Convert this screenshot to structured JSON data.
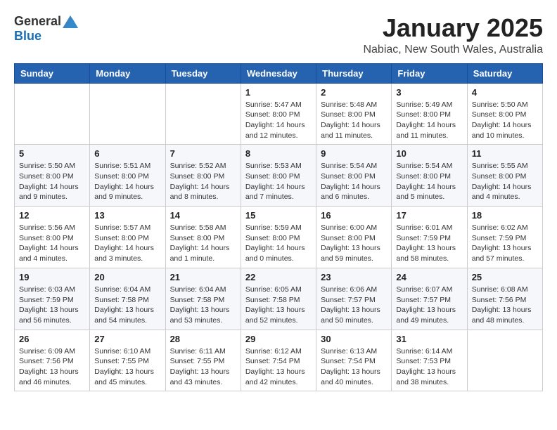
{
  "header": {
    "logo": {
      "general": "General",
      "blue": "Blue"
    },
    "title": "January 2025",
    "subtitle": "Nabiac, New South Wales, Australia"
  },
  "days_of_week": [
    "Sunday",
    "Monday",
    "Tuesday",
    "Wednesday",
    "Thursday",
    "Friday",
    "Saturday"
  ],
  "weeks": [
    {
      "cells": [
        {
          "day": "",
          "info": ""
        },
        {
          "day": "",
          "info": ""
        },
        {
          "day": "",
          "info": ""
        },
        {
          "day": "1",
          "info": "Sunrise: 5:47 AM\nSunset: 8:00 PM\nDaylight: 14 hours and 12 minutes."
        },
        {
          "day": "2",
          "info": "Sunrise: 5:48 AM\nSunset: 8:00 PM\nDaylight: 14 hours and 11 minutes."
        },
        {
          "day": "3",
          "info": "Sunrise: 5:49 AM\nSunset: 8:00 PM\nDaylight: 14 hours and 11 minutes."
        },
        {
          "day": "4",
          "info": "Sunrise: 5:50 AM\nSunset: 8:00 PM\nDaylight: 14 hours and 10 minutes."
        }
      ]
    },
    {
      "cells": [
        {
          "day": "5",
          "info": "Sunrise: 5:50 AM\nSunset: 8:00 PM\nDaylight: 14 hours and 9 minutes."
        },
        {
          "day": "6",
          "info": "Sunrise: 5:51 AM\nSunset: 8:00 PM\nDaylight: 14 hours and 9 minutes."
        },
        {
          "day": "7",
          "info": "Sunrise: 5:52 AM\nSunset: 8:00 PM\nDaylight: 14 hours and 8 minutes."
        },
        {
          "day": "8",
          "info": "Sunrise: 5:53 AM\nSunset: 8:00 PM\nDaylight: 14 hours and 7 minutes."
        },
        {
          "day": "9",
          "info": "Sunrise: 5:54 AM\nSunset: 8:00 PM\nDaylight: 14 hours and 6 minutes."
        },
        {
          "day": "10",
          "info": "Sunrise: 5:54 AM\nSunset: 8:00 PM\nDaylight: 14 hours and 5 minutes."
        },
        {
          "day": "11",
          "info": "Sunrise: 5:55 AM\nSunset: 8:00 PM\nDaylight: 14 hours and 4 minutes."
        }
      ]
    },
    {
      "cells": [
        {
          "day": "12",
          "info": "Sunrise: 5:56 AM\nSunset: 8:00 PM\nDaylight: 14 hours and 4 minutes."
        },
        {
          "day": "13",
          "info": "Sunrise: 5:57 AM\nSunset: 8:00 PM\nDaylight: 14 hours and 3 minutes."
        },
        {
          "day": "14",
          "info": "Sunrise: 5:58 AM\nSunset: 8:00 PM\nDaylight: 14 hours and 1 minute."
        },
        {
          "day": "15",
          "info": "Sunrise: 5:59 AM\nSunset: 8:00 PM\nDaylight: 14 hours and 0 minutes."
        },
        {
          "day": "16",
          "info": "Sunrise: 6:00 AM\nSunset: 8:00 PM\nDaylight: 13 hours and 59 minutes."
        },
        {
          "day": "17",
          "info": "Sunrise: 6:01 AM\nSunset: 7:59 PM\nDaylight: 13 hours and 58 minutes."
        },
        {
          "day": "18",
          "info": "Sunrise: 6:02 AM\nSunset: 7:59 PM\nDaylight: 13 hours and 57 minutes."
        }
      ]
    },
    {
      "cells": [
        {
          "day": "19",
          "info": "Sunrise: 6:03 AM\nSunset: 7:59 PM\nDaylight: 13 hours and 56 minutes."
        },
        {
          "day": "20",
          "info": "Sunrise: 6:04 AM\nSunset: 7:58 PM\nDaylight: 13 hours and 54 minutes."
        },
        {
          "day": "21",
          "info": "Sunrise: 6:04 AM\nSunset: 7:58 PM\nDaylight: 13 hours and 53 minutes."
        },
        {
          "day": "22",
          "info": "Sunrise: 6:05 AM\nSunset: 7:58 PM\nDaylight: 13 hours and 52 minutes."
        },
        {
          "day": "23",
          "info": "Sunrise: 6:06 AM\nSunset: 7:57 PM\nDaylight: 13 hours and 50 minutes."
        },
        {
          "day": "24",
          "info": "Sunrise: 6:07 AM\nSunset: 7:57 PM\nDaylight: 13 hours and 49 minutes."
        },
        {
          "day": "25",
          "info": "Sunrise: 6:08 AM\nSunset: 7:56 PM\nDaylight: 13 hours and 48 minutes."
        }
      ]
    },
    {
      "cells": [
        {
          "day": "26",
          "info": "Sunrise: 6:09 AM\nSunset: 7:56 PM\nDaylight: 13 hours and 46 minutes."
        },
        {
          "day": "27",
          "info": "Sunrise: 6:10 AM\nSunset: 7:55 PM\nDaylight: 13 hours and 45 minutes."
        },
        {
          "day": "28",
          "info": "Sunrise: 6:11 AM\nSunset: 7:55 PM\nDaylight: 13 hours and 43 minutes."
        },
        {
          "day": "29",
          "info": "Sunrise: 6:12 AM\nSunset: 7:54 PM\nDaylight: 13 hours and 42 minutes."
        },
        {
          "day": "30",
          "info": "Sunrise: 6:13 AM\nSunset: 7:54 PM\nDaylight: 13 hours and 40 minutes."
        },
        {
          "day": "31",
          "info": "Sunrise: 6:14 AM\nSunset: 7:53 PM\nDaylight: 13 hours and 38 minutes."
        },
        {
          "day": "",
          "info": ""
        }
      ]
    }
  ]
}
